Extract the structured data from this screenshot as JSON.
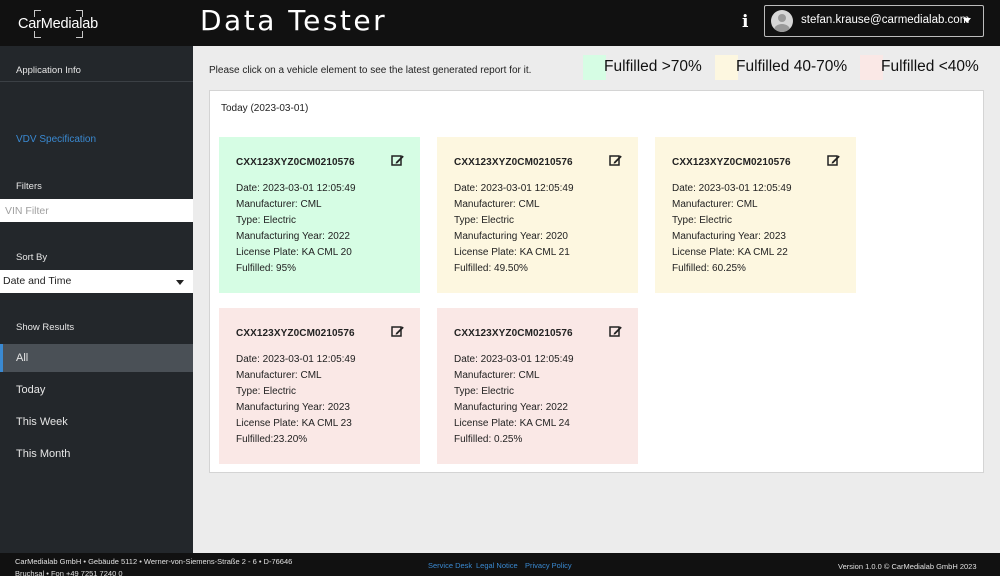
{
  "header": {
    "logo_text": "CarMedialab",
    "title": "Data Tester",
    "info_icon": "info-icon",
    "user_email": "stefan.krause@carmedialab.com"
  },
  "sidebar": {
    "application_info": "Application Info",
    "vdv_specification": "VDV Specification",
    "filters_label": "Filters",
    "vin_placeholder": "VIN Filter",
    "sort_label": "Sort By",
    "sort_value": "Date and Time",
    "show_results_label": "Show Results",
    "results": [
      {
        "label": "All",
        "active": true
      },
      {
        "label": "Today",
        "active": false
      },
      {
        "label": "This Week",
        "active": false
      },
      {
        "label": "This Month",
        "active": false
      }
    ]
  },
  "main": {
    "instruction": "Please click on a vehicle element to see the latest generated report for it.",
    "legend": [
      {
        "label": "Fulfilled >70%",
        "color": "#d6fde4"
      },
      {
        "label": "Fulfilled 40-70%",
        "color": "#fdf7e0"
      },
      {
        "label": "Fulfilled <40%",
        "color": "#fae8e6"
      }
    ],
    "panel_date": "Today (2023-03-01)",
    "cards": [
      {
        "vin": "CXX123XYZ0CM0210576",
        "date": "Date: 2023-03-01 12:05:49",
        "manufacturer": "Manufacturer: CML",
        "type": "Type: Electric",
        "year": "Manufacturing Year: 2022",
        "plate": "License Plate: KA CML 20",
        "fulfilled": "Fulfilled: 95%",
        "color": "#d6fde4"
      },
      {
        "vin": "CXX123XYZ0CM0210576",
        "date": "Date: 2023-03-01 12:05:49",
        "manufacturer": "Manufacturer: CML",
        "type": "Type: Electric",
        "year": "Manufacturing Year: 2020",
        "plate": "License Plate: KA CML 21",
        "fulfilled": "Fulfilled: 49.50%",
        "color": "#fdf7e0"
      },
      {
        "vin": "CXX123XYZ0CM0210576",
        "date": "Date: 2023-03-01 12:05:49",
        "manufacturer": "Manufacturer: CML",
        "type": "Type: Electric",
        "year": "Manufacturing Year: 2023",
        "plate": "License Plate: KA CML 22",
        "fulfilled": "Fulfilled: 60.25%",
        "color": "#fdf7e0"
      },
      {
        "vin": "CXX123XYZ0CM0210576",
        "date": "Date: 2023-03-01 12:05:49",
        "manufacturer": "Manufacturer: CML",
        "type": "Type: Electric",
        "year": "Manufacturing Year: 2023",
        "plate": "License Plate: KA CML 23",
        "fulfilled": "Fulfilled:23.20%",
        "color": "#fae8e6"
      },
      {
        "vin": "CXX123XYZ0CM0210576",
        "date": "Date: 2023-03-01 12:05:49",
        "manufacturer": "Manufacturer: CML",
        "type": "Type: Electric",
        "year": "Manufacturing Year: 2022",
        "plate": "License Plate: KA CML 24",
        "fulfilled": "Fulfilled: 0.25%",
        "color": "#fae8e6"
      }
    ]
  },
  "footer": {
    "address_line1": "CarMedialab GmbH • Gebäude 5112 • Werner-von-Siemens-Straße 2 - 6 • D-76646",
    "address_line2": "Bruchsal • Fon +49 7251 7240 0",
    "service_desk": "Service Desk",
    "legal_notice": "Legal Notice",
    "privacy_policy": "Privacy Policy",
    "version": "Version 1.0.0 © CarMedialab GmbH 2023"
  }
}
